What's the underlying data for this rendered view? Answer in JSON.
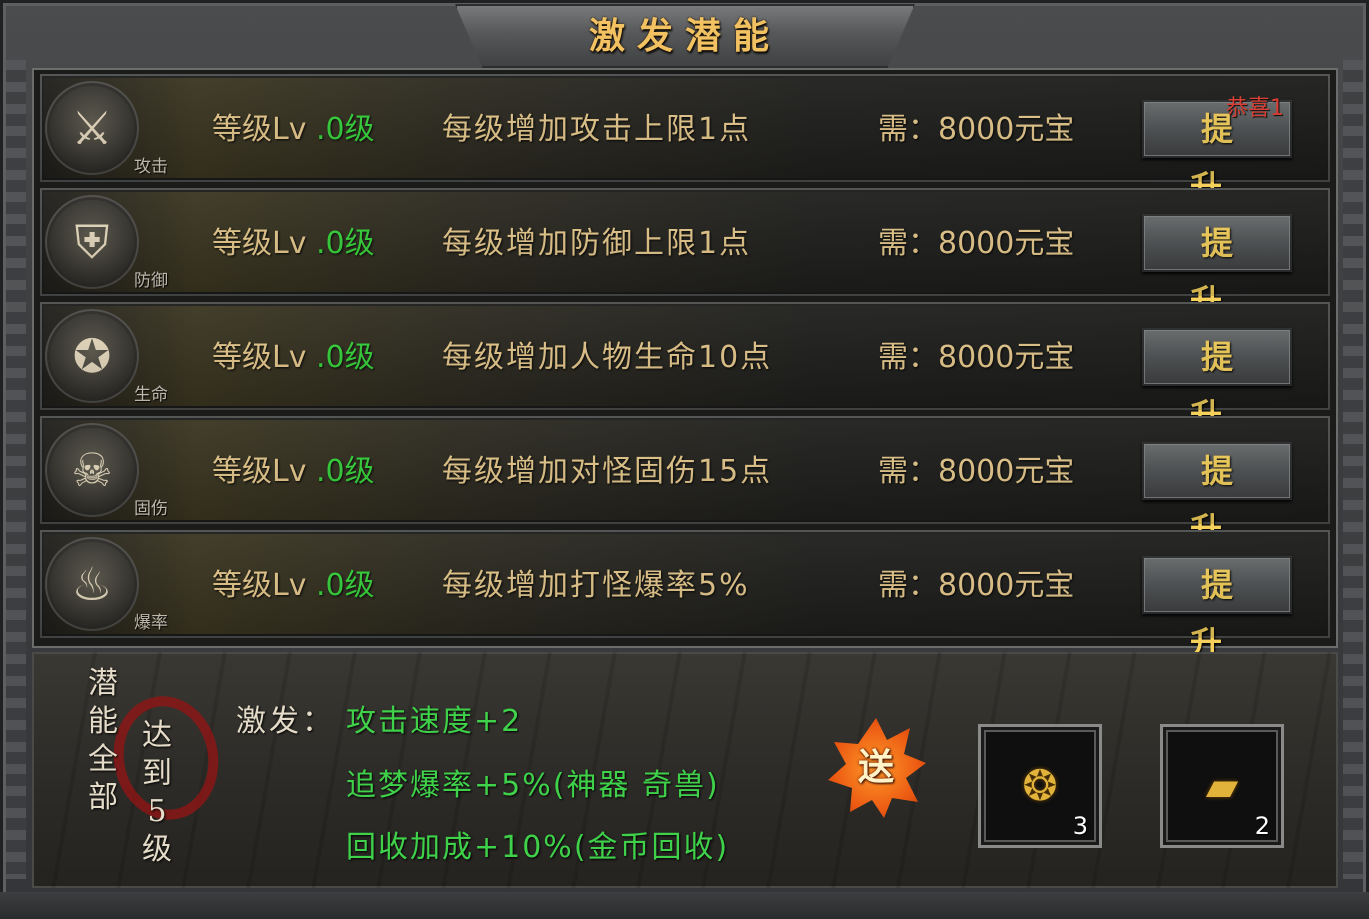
{
  "title": "激发潜能",
  "rows": [
    {
      "icon": "swords-icon",
      "icon_glyph": "⚔",
      "icon_label": "攻击",
      "lv_prefix": "等级Lv",
      "lv_value": ".0级",
      "desc": "每级增加攻击上限1点",
      "cost": "需：8000元宝",
      "button": "提 升"
    },
    {
      "icon": "shield-icon",
      "icon_glyph": "⛨",
      "icon_label": "防御",
      "lv_prefix": "等级Lv",
      "lv_value": ".0级",
      "desc": "每级增加防御上限1点",
      "cost": "需：8000元宝",
      "button": "提 升"
    },
    {
      "icon": "life-icon",
      "icon_glyph": "✪",
      "icon_label": "生命",
      "lv_prefix": "等级Lv",
      "lv_value": ".0级",
      "desc": "每级增加人物生命10点",
      "cost": "需：8000元宝",
      "button": "提 升"
    },
    {
      "icon": "skull-damage-icon",
      "icon_glyph": "☠",
      "icon_label": "固伤",
      "lv_prefix": "等级Lv",
      "lv_value": ".0级",
      "desc": "每级增加对怪固伤15点",
      "cost": "需：8000元宝",
      "button": "提 升"
    },
    {
      "icon": "drop-rate-icon",
      "icon_glyph": "♨",
      "icon_label": "爆率",
      "lv_prefix": "等级Lv",
      "lv_value": ".0级",
      "desc": "每级增加打怪爆率5%",
      "cost": "需：8000元宝",
      "button": "提 升"
    }
  ],
  "congrats": "恭喜1",
  "condition": {
    "col1": [
      "潜",
      "能",
      "全",
      "部"
    ],
    "col2": [
      "达",
      "到",
      "5",
      "级"
    ]
  },
  "activate": {
    "label": "激发：",
    "bonuses": [
      "攻击速度+2",
      "追梦爆率+5%(神器  奇兽)",
      "回收加成+10%(金币回收)"
    ]
  },
  "gift_label": "送",
  "rewards": [
    {
      "icon": "pouch-icon",
      "glyph": "❂",
      "count": "3"
    },
    {
      "icon": "gold-ingot-icon",
      "glyph": "▰",
      "count": "2"
    }
  ],
  "colors": {
    "accent_gold": "#e7c98c",
    "green": "#35d33a",
    "button_text": "#f5d15b",
    "congrats_red": "#e03a2e"
  }
}
